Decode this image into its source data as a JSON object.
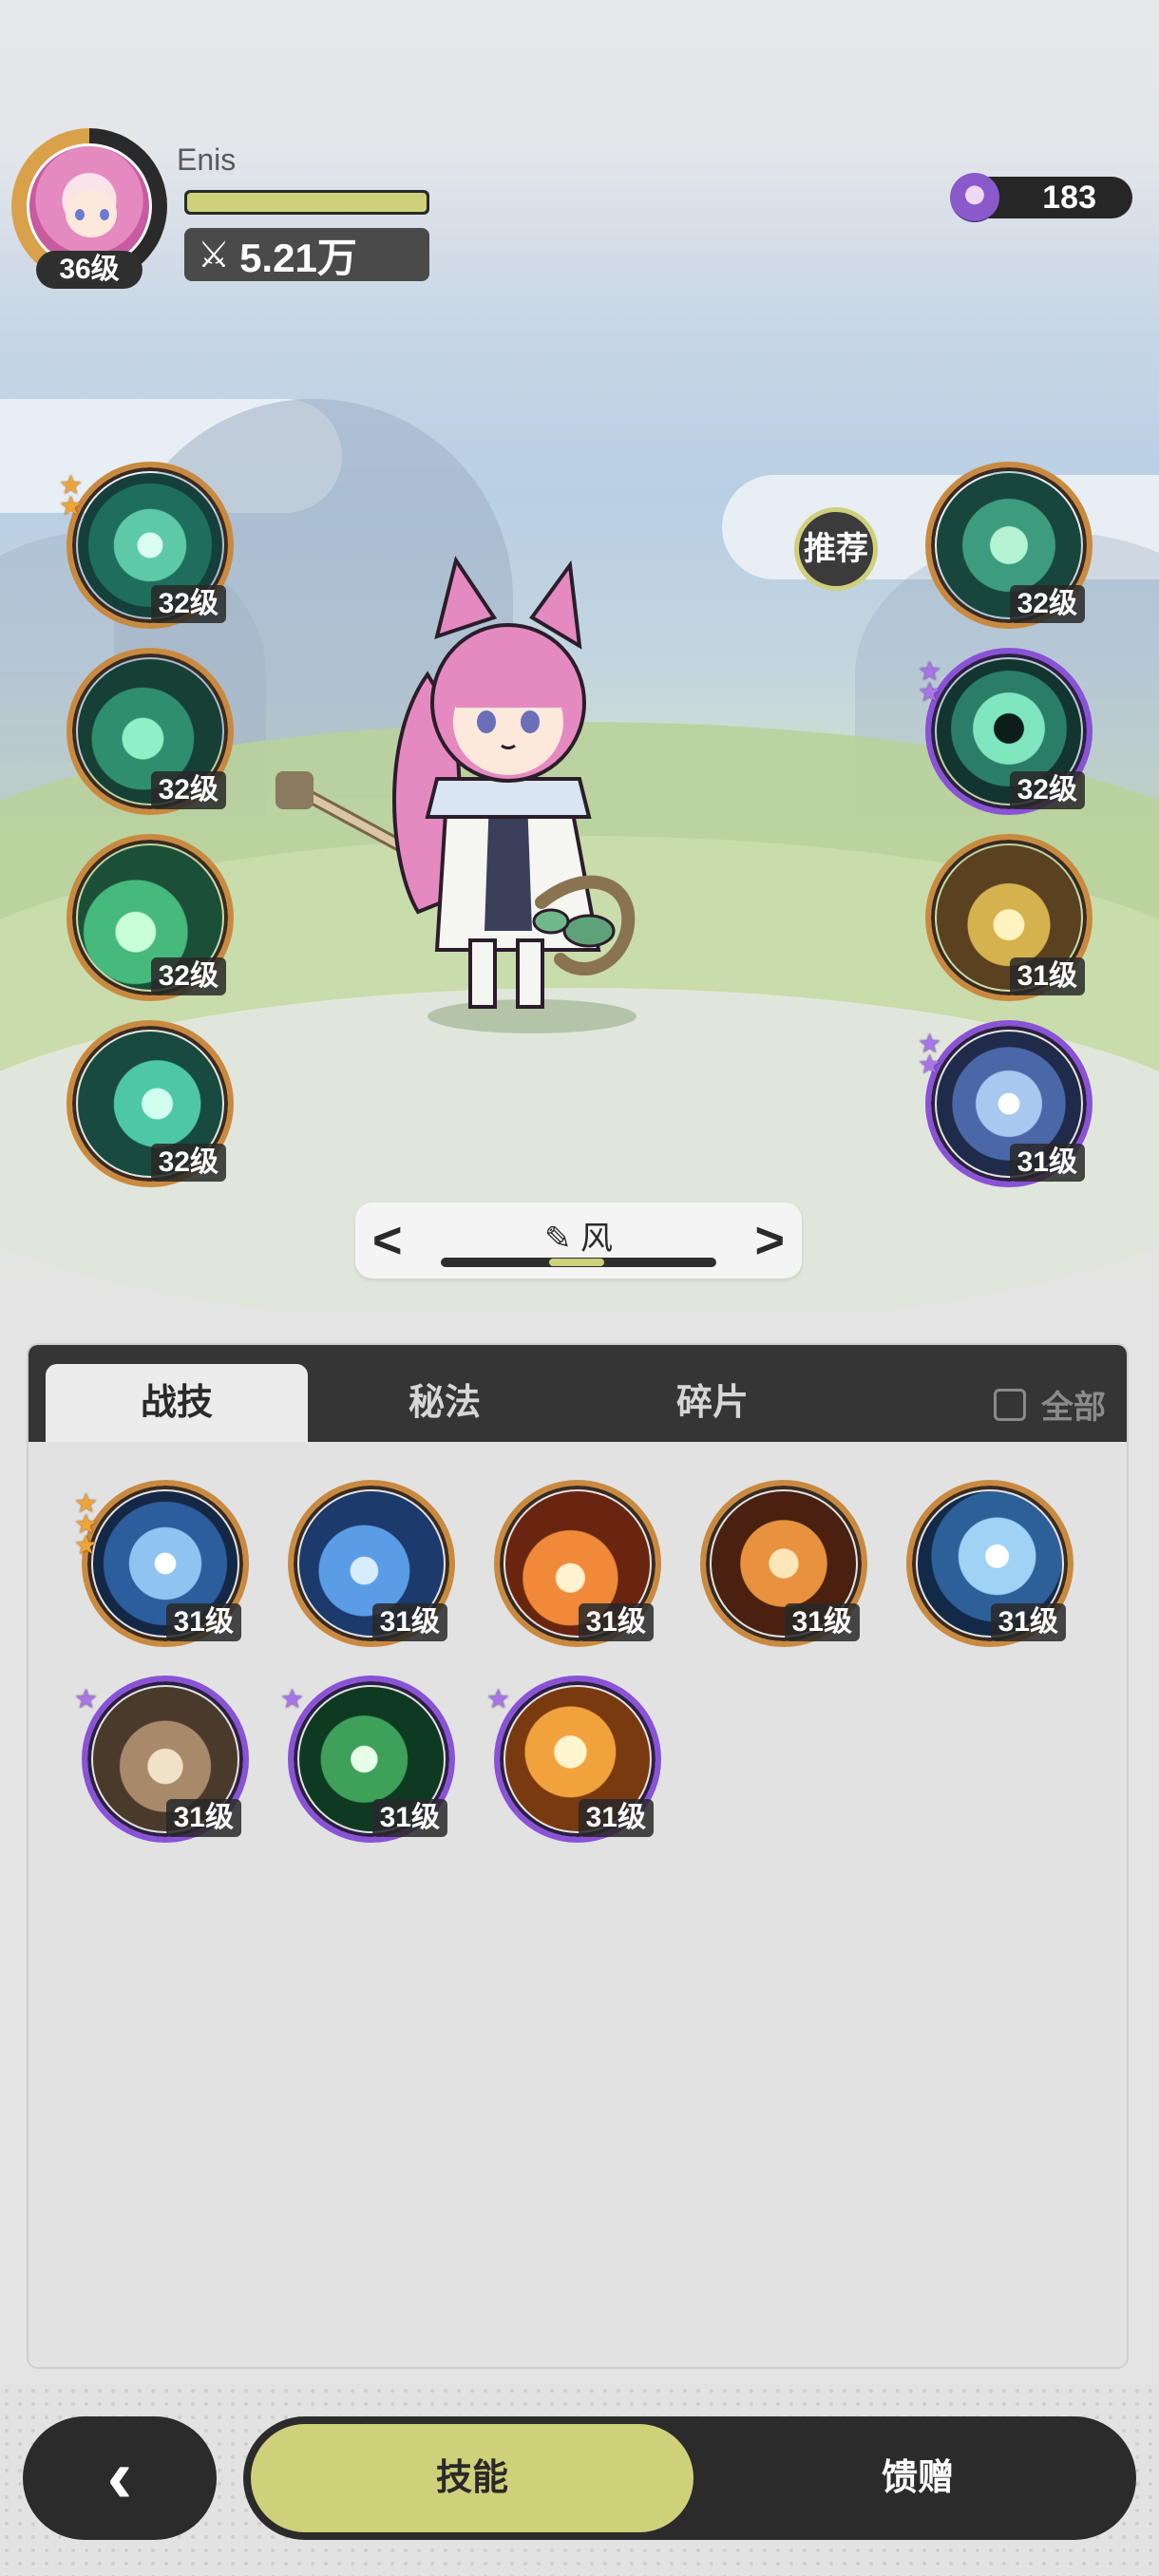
{
  "player": {
    "name": "Enis",
    "level": "36级",
    "power": "5.21万",
    "power_icon": "crossed-swords-icon"
  },
  "currency": {
    "amount": "183",
    "icon": "character-token-icon"
  },
  "equipped_left": [
    {
      "id": "wind-vortex",
      "level": "32级",
      "stars": 2,
      "star_color": "gold",
      "frame": "orange"
    },
    {
      "id": "thorn-vine",
      "level": "32级",
      "stars": 0,
      "frame": "orange"
    },
    {
      "id": "wind-blade",
      "level": "32级",
      "stars": 0,
      "frame": "orange"
    },
    {
      "id": "wind-slash",
      "level": "32级",
      "stars": 0,
      "frame": "orange"
    }
  ],
  "equipped_right": [
    {
      "id": "cyclone-orb",
      "level": "32级",
      "stars": 0,
      "frame": "orange"
    },
    {
      "id": "wind-eye",
      "level": "32级",
      "stars": 2,
      "star_color": "purple",
      "frame": "purple"
    },
    {
      "id": "golden-arrows",
      "level": "31级",
      "stars": 0,
      "frame": "orange"
    },
    {
      "id": "crystal-star",
      "level": "31级",
      "stars": 2,
      "star_color": "purple",
      "frame": "purple"
    }
  ],
  "recommend_label": "推荐",
  "element_switcher": {
    "label": "风",
    "icon": "pencil-icon",
    "prev": "<",
    "next": ">"
  },
  "tabs": {
    "combat": "战技",
    "secret": "秘法",
    "fragments": "碎片",
    "show_all": "全部"
  },
  "inventory": [
    {
      "id": "ice-burst",
      "level": "31级",
      "stars": 3,
      "star_color": "gold",
      "frame": "orange"
    },
    {
      "id": "water-fist",
      "level": "31级",
      "stars": 0,
      "frame": "orange"
    },
    {
      "id": "fire-blast",
      "level": "31级",
      "stars": 0,
      "frame": "orange"
    },
    {
      "id": "flame-swirl",
      "level": "31级",
      "stars": 0,
      "frame": "orange"
    },
    {
      "id": "ice-crystal",
      "level": "31级",
      "stars": 0,
      "frame": "orange"
    },
    {
      "id": "stone-cards",
      "level": "31级",
      "stars": 1,
      "star_color": "purple",
      "frame": "purple"
    },
    {
      "id": "heal-cross",
      "level": "31级",
      "stars": 1,
      "star_color": "purple",
      "frame": "purple"
    },
    {
      "id": "fire-orb",
      "level": "31级",
      "stars": 1,
      "star_color": "purple",
      "frame": "purple"
    }
  ],
  "bottom_nav": {
    "back_icon": "chevron-left-icon",
    "skills": "技能",
    "gift": "馈赠"
  },
  "colors": {
    "accent": "#cfd07a",
    "gold_frame": "#c98a3f",
    "purple_frame": "#8a52d6",
    "dark": "#2b2b2b"
  }
}
